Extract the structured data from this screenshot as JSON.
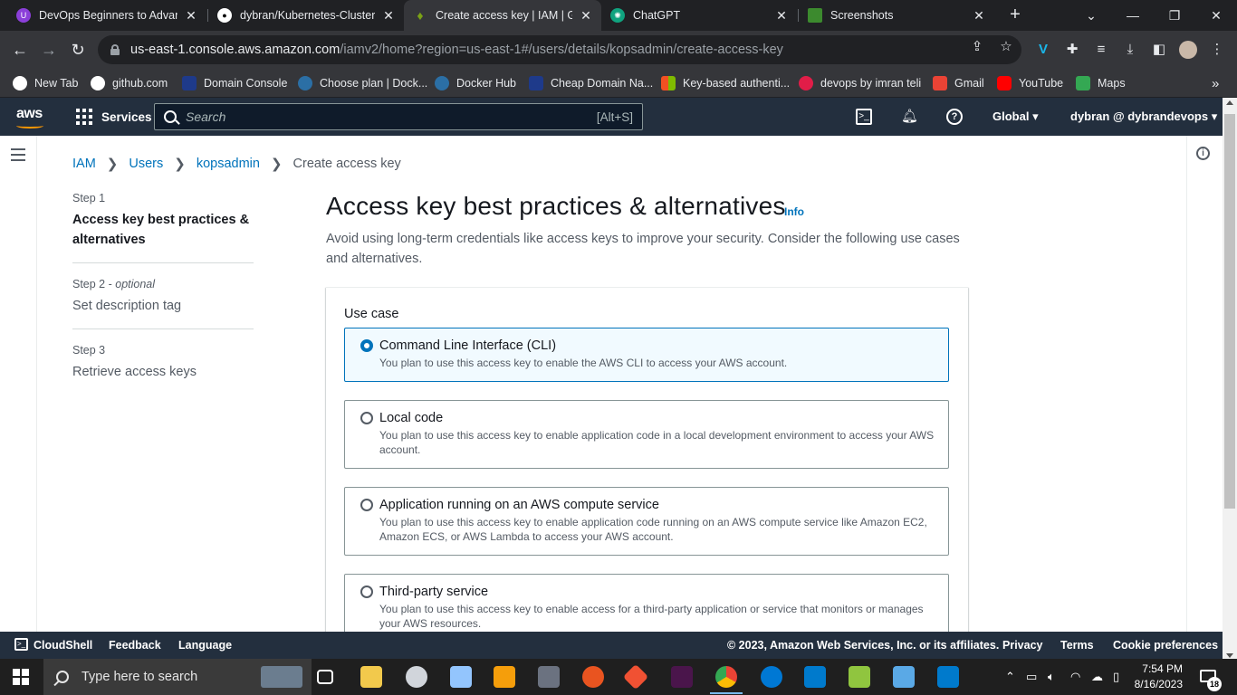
{
  "browser": {
    "tabs": [
      {
        "title": "DevOps Beginners to Advanc",
        "color": "#8b3fd9",
        "active": false
      },
      {
        "title": "dybran/Kubernetes-Cluster-S",
        "color": "#ffffff",
        "active": false
      },
      {
        "title": "Create access key | IAM | Glo",
        "color": "#7aa116",
        "active": true
      },
      {
        "title": "ChatGPT",
        "color": "#10a37f",
        "active": false
      },
      {
        "title": "Screenshots",
        "color": "#3c8a2e",
        "active": false
      }
    ],
    "url_host": "us-east-1.console.aws.amazon.com",
    "url_path": "/iamv2/home?region=us-east-1#/users/details/kopsadmin/create-access-key",
    "bookmarks": [
      {
        "label": "New Tab",
        "color": "#ffffff"
      },
      {
        "label": "github.com",
        "color": "#ffffff"
      },
      {
        "label": "Domain Console",
        "color": "#1e3a8a"
      },
      {
        "label": "Choose plan | Dock...",
        "color": "#2496ed"
      },
      {
        "label": "Docker Hub",
        "color": "#2496ed"
      },
      {
        "label": "Cheap Domain Na...",
        "color": "#1e3a8a"
      },
      {
        "label": "Key-based authenti...",
        "color": "#f25022"
      },
      {
        "label": "devops by imran teli",
        "color": "#e11d48"
      },
      {
        "label": "Gmail",
        "color": "#ea4335"
      },
      {
        "label": "YouTube",
        "color": "#ff0000"
      },
      {
        "label": "Maps",
        "color": "#34a853"
      }
    ]
  },
  "aws_header": {
    "logo": "aws",
    "services": "Services",
    "search_placeholder": "Search",
    "search_shortcut": "[Alt+S]",
    "region": "Global",
    "account": "dybran @ dybrandevops"
  },
  "breadcrumb": {
    "items": [
      "IAM",
      "Users",
      "kopsadmin"
    ],
    "current": "Create access key"
  },
  "steps": [
    {
      "num": "Step 1",
      "optional": "",
      "label": "Access key best practices & alternatives",
      "active": true
    },
    {
      "num": "Step 2",
      "optional": "optional",
      "label": "Set description tag",
      "active": false
    },
    {
      "num": "Step 3",
      "optional": "",
      "label": "Retrieve access keys",
      "active": false
    }
  ],
  "main": {
    "title": "Access key best practices & alternatives",
    "info": "Info",
    "description": "Avoid using long-term credentials like access keys to improve your security. Consider the following use cases and alternatives.",
    "use_case_label": "Use case",
    "options": [
      {
        "title": "Command Line Interface (CLI)",
        "desc": "You plan to use this access key to enable the AWS CLI to access your AWS account.",
        "selected": true
      },
      {
        "title": "Local code",
        "desc": "You plan to use this access key to enable application code in a local development environment to access your AWS account.",
        "selected": false
      },
      {
        "title": "Application running on an AWS compute service",
        "desc": "You plan to use this access key to enable application code running on an AWS compute service like Amazon EC2, Amazon ECS, or AWS Lambda to access your AWS account.",
        "selected": false
      },
      {
        "title": "Third-party service",
        "desc": "You plan to use this access key to enable access for a third-party application or service that monitors or manages your AWS resources.",
        "selected": false
      }
    ]
  },
  "footer": {
    "cloudshell": "CloudShell",
    "feedback": "Feedback",
    "language": "Language",
    "copyright": "© 2023, Amazon Web Services, Inc. or its affiliates.",
    "privacy": "Privacy",
    "terms": "Terms",
    "cookie": "Cookie preferences"
  },
  "taskbar": {
    "search_placeholder": "Type here to search",
    "time": "7:54 PM",
    "date": "8/16/2023",
    "notifications": "18",
    "apps": [
      {
        "name": "task-view",
        "color": "#ffffff"
      },
      {
        "name": "file-explorer",
        "color": "#f2c94c"
      },
      {
        "name": "app-paint",
        "color": "#d1d5db"
      },
      {
        "name": "app-snip",
        "color": "#93c5fd"
      },
      {
        "name": "app-media",
        "color": "#f59e0b"
      },
      {
        "name": "app-photos",
        "color": "#6b7280"
      },
      {
        "name": "app-ubuntu",
        "color": "#e95420"
      },
      {
        "name": "app-git",
        "color": "#f05133"
      },
      {
        "name": "app-slack",
        "color": "#4a154b"
      },
      {
        "name": "app-chrome",
        "color": "#34a853"
      },
      {
        "name": "app-skype",
        "color": "#0078d4"
      },
      {
        "name": "app-vscode",
        "color": "#007acc"
      },
      {
        "name": "app-notepadpp",
        "color": "#90c53f"
      },
      {
        "name": "app-remote",
        "color": "#5aa9e6"
      },
      {
        "name": "app-vscode-2",
        "color": "#007acc"
      }
    ]
  }
}
